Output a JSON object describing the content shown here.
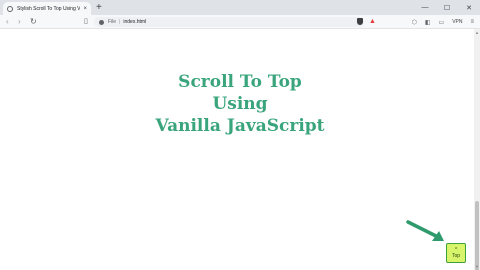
{
  "browser": {
    "tab_title": "Stylish Scroll To Top Using Vanill",
    "tab_close": "×",
    "new_tab": "+",
    "window_controls": {
      "minimize": "—",
      "maximize": "☐",
      "close": "✕"
    },
    "nav": {
      "back": "‹",
      "forward": "›",
      "reload": "↻"
    },
    "url_scheme": "File",
    "url_sep": "|",
    "url": "index.html",
    "vpn_label": "VPN",
    "menu": "≡"
  },
  "page": {
    "heading_lines": [
      "Scroll To Top",
      "Using",
      "Vanilla JavaScript"
    ],
    "top_button_chevron": "^",
    "top_button_label": "Top"
  },
  "colors": {
    "heading": "#3aa57c",
    "top_button_bg": "#d8f46a",
    "arrow": "#2e9a6e"
  }
}
